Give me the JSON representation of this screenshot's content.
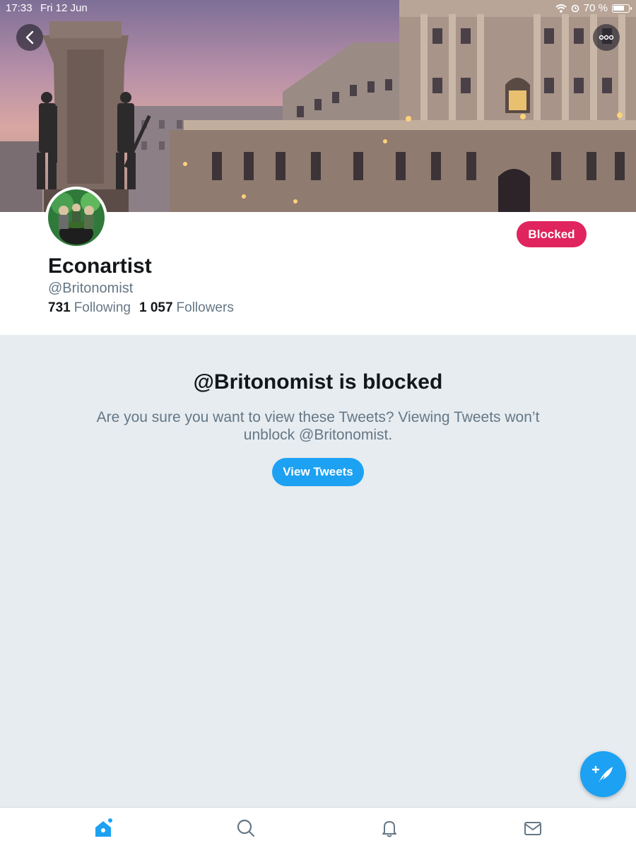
{
  "status_bar": {
    "time": "17:33",
    "date": "Fri 12 Jun",
    "battery": "70 %",
    "icons": [
      "wifi-icon",
      "alarm-icon",
      "battery-icon"
    ]
  },
  "nav": {
    "back_icon": "chevron-left-icon",
    "more_icon": "more-dots-icon"
  },
  "profile": {
    "display_name": "Econartist",
    "handle": "@Britonomist",
    "following_count": "731",
    "following_label": "Following",
    "followers_count": "1 057",
    "followers_label": "Followers",
    "blocked_label": "Blocked"
  },
  "blocked_notice": {
    "title": "@Britonomist is blocked",
    "body": "Are you sure you want to view these Tweets? Viewing Tweets won’t unblock @Britonomist.",
    "button_label": "View Tweets"
  },
  "tabs": [
    {
      "name": "home",
      "icon": "home-icon",
      "active": true
    },
    {
      "name": "search",
      "icon": "search-icon",
      "active": false
    },
    {
      "name": "notifications",
      "icon": "bell-icon",
      "active": false
    },
    {
      "name": "messages",
      "icon": "mail-icon",
      "active": false
    }
  ],
  "fab": {
    "icon": "compose-tweet-icon"
  },
  "colors": {
    "accent": "#1da1f2",
    "blocked": "#e0245e",
    "background": "#e6ecf0",
    "secondary_text": "#657786"
  }
}
